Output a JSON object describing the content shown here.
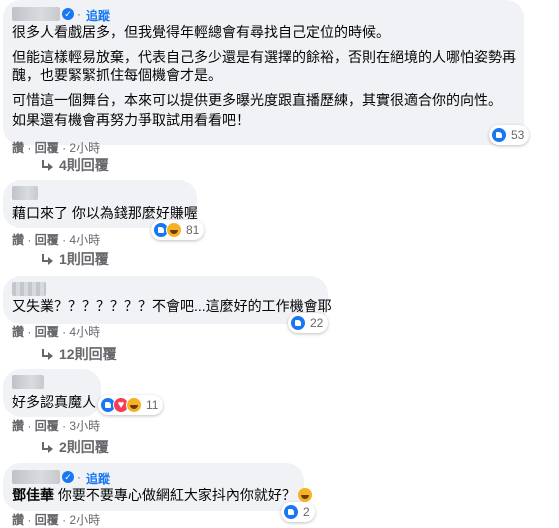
{
  "labels": {
    "follow": "追蹤",
    "like": "讚",
    "reply": "回覆",
    "dot": "·"
  },
  "comments": [
    {
      "follow": "追蹤",
      "lines": [
        "很多人看戲居多，但我覺得年輕總會有尋找自己定位的時候。",
        "但能這樣輕易放棄，代表自己多少還是有選擇的餘裕，否則在絕境的人哪怕姿勢再",
        "醜，也要緊緊抓住每個機會才是。",
        "可惜這一個舞台，本來可以提供更多曝光度跟直播歷練，其實很適合你的向性。",
        "如果還有機會再努力爭取試用看看吧！"
      ],
      "reaction_count": "53",
      "reactions": [
        "like"
      ],
      "time": "2小時",
      "replies": "4則回覆"
    },
    {
      "lines": [
        "藉口來了 你以為錢那麼好賺喔"
      ],
      "reaction_count": "81",
      "reactions": [
        "like",
        "haha"
      ],
      "time": "4小時",
      "replies": "1則回覆"
    },
    {
      "lines": [
        "又失業？？？？？？？不會吧...這麼好的工作機會耶"
      ],
      "reaction_count": "22",
      "reactions": [
        "like"
      ],
      "time": "4小時",
      "replies": "12則回覆"
    },
    {
      "lines": [
        "好多認真魔人"
      ],
      "reaction_count": "11",
      "reactions": [
        "like",
        "love",
        "haha"
      ],
      "time": "3小時",
      "replies": "2則回覆"
    },
    {
      "follow": "追蹤",
      "mention": "鄧佳華",
      "lines": [
        "你要不要專心做網紅大家抖內你就好？"
      ],
      "reaction_count": "2",
      "reactions": [
        "like"
      ],
      "time": "2小時"
    }
  ],
  "icons": {
    "verified": "verified-badge-icon",
    "like": "like-reaction-icon",
    "haha": "haha-reaction-icon",
    "love": "love-reaction-icon",
    "reply_arrow": "reply-arrow-icon",
    "emoji": "grinning-emoji-icon"
  },
  "colors": {
    "bubble": "#f0f2f5",
    "link_blue": "#1877f2",
    "meta_gray": "#65676b"
  }
}
